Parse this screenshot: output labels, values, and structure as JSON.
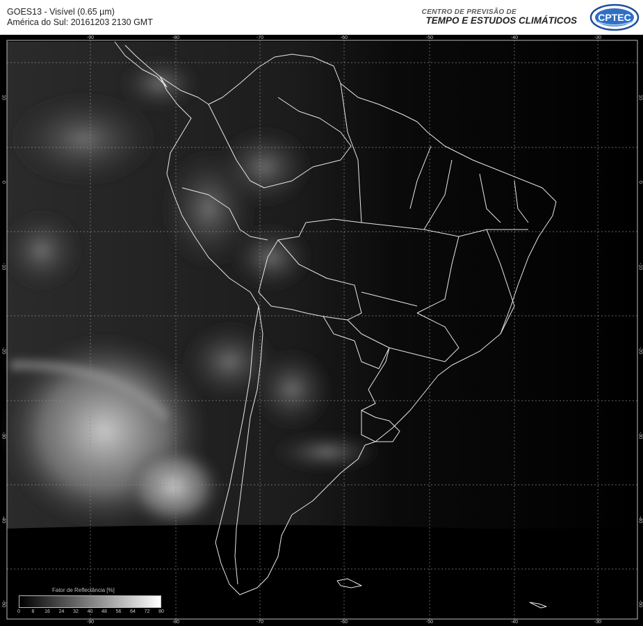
{
  "header": {
    "title_line1": "GOES13 - Visível (0.65 µm)",
    "title_line2": "América do Sul: 20161203 2130 GMT",
    "institution_small": "CENTRO DE PREVISÃO DE",
    "institution_big": "TEMPO E ESTUDOS CLIMÁTICOS",
    "logo_text": "CPTEC"
  },
  "map": {
    "longitude_labels": [
      "-90",
      "-80",
      "-70",
      "-60",
      "-50",
      "-40",
      "-30"
    ],
    "latitude_labels": [
      "10",
      "0",
      "-10",
      "-20",
      "-30",
      "-40",
      "-50"
    ]
  },
  "legend": {
    "title": "Fator de Reflectância [%]",
    "ticks": [
      "0",
      "8",
      "16",
      "24",
      "32",
      "40",
      "48",
      "56",
      "64",
      "72",
      "80"
    ],
    "min": 0,
    "max": 80
  },
  "colors": {
    "background": "#000000",
    "header_bg": "#ffffff",
    "boundaries": "#e8e8e8",
    "grid": "#8a8a8a",
    "logo": "#1f4e9c"
  }
}
